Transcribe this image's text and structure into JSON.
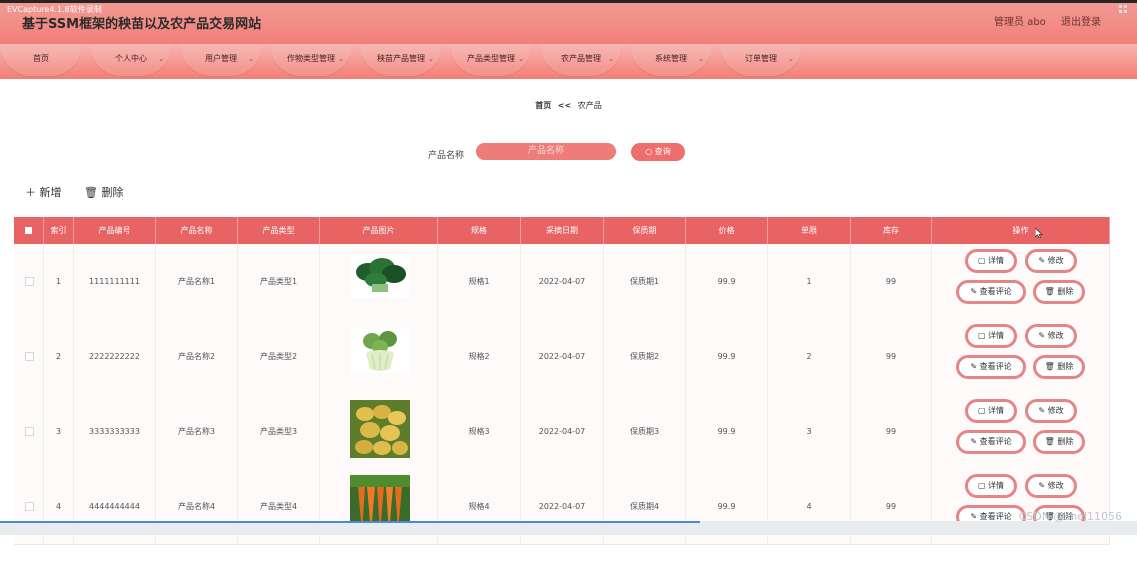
{
  "header": {
    "capture_label": "EVCapture4.1.8软件录制",
    "title": "基于SSM框架的秧苗以及农产品交易网站",
    "admin_label": "管理员 abo",
    "logout": "退出登录"
  },
  "nav": [
    {
      "label": "首页",
      "has_chevron": false
    },
    {
      "label": "个人中心",
      "has_chevron": true
    },
    {
      "label": "用户管理",
      "has_chevron": true
    },
    {
      "label": "作物类型管理",
      "has_chevron": true
    },
    {
      "label": "秧苗产品管理",
      "has_chevron": true
    },
    {
      "label": "产品类型管理",
      "has_chevron": true
    },
    {
      "label": "农产品管理",
      "has_chevron": true
    },
    {
      "label": "系统管理",
      "has_chevron": true
    },
    {
      "label": "订单管理",
      "has_chevron": true
    }
  ],
  "breadcrumb": {
    "home": "首页",
    "sep": "<<",
    "current": "农产品"
  },
  "search": {
    "label": "产品名称",
    "placeholder": "产品名称",
    "button": "查询"
  },
  "toolbar": {
    "add": "新增",
    "delete": "删除"
  },
  "table": {
    "columns": [
      "索引",
      "产品编号",
      "产品名称",
      "产品类型",
      "产品图片",
      "规格",
      "采摘日期",
      "保质期",
      "价格",
      "单限",
      "库存",
      "操作"
    ],
    "rows": [
      {
        "index": "1",
        "code": "1111111111",
        "name": "产品名称1",
        "type": "产品类型1",
        "image": "leafy-greens",
        "spec": "规格1",
        "date": "2022-04-07",
        "shelf": "保质期1",
        "price": "99.9",
        "limit": "1",
        "stock": "99"
      },
      {
        "index": "2",
        "code": "2222222222",
        "name": "产品名称2",
        "type": "产品类型2",
        "image": "bok-choy",
        "spec": "规格2",
        "date": "2022-04-07",
        "shelf": "保质期2",
        "price": "99.9",
        "limit": "2",
        "stock": "99"
      },
      {
        "index": "3",
        "code": "3333333333",
        "name": "产品名称3",
        "type": "产品类型3",
        "image": "potatoes",
        "spec": "规格3",
        "date": "2022-04-07",
        "shelf": "保质期3",
        "price": "99.9",
        "limit": "3",
        "stock": "99"
      },
      {
        "index": "4",
        "code": "4444444444",
        "name": "产品名称4",
        "type": "产品类型4",
        "image": "carrots",
        "spec": "规格4",
        "date": "2022-04-07",
        "shelf": "保质期4",
        "price": "99.9",
        "limit": "4",
        "stock": "99"
      }
    ],
    "actions": {
      "detail": "详情",
      "edit": "修改",
      "review": "查看评论",
      "delete": "删除"
    }
  },
  "watermark": "CSDN @shej11056",
  "colors": {
    "primary": "#e86464",
    "nav": "#f27f78",
    "button_border": "#e58585"
  }
}
